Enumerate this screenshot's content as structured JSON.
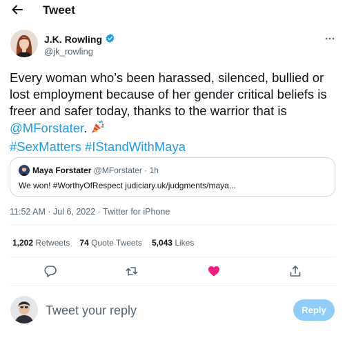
{
  "header": {
    "title": "Tweet"
  },
  "author": {
    "name": "J.K. Rowling",
    "handle": "@jk_rowling",
    "verified": true
  },
  "tweet": {
    "text_main": "Every woman who’s been harassed, silenced, bullied or lost employment because of her gender critical beliefs is freer and safer today, thanks to the warrior that is ",
    "mention": "@MForstater",
    "text_after_mention": ".",
    "emoji": "party-popper",
    "hashtag_1": "#SexMatters",
    "hashtag_2": "#IStandWithMaya"
  },
  "quote": {
    "name": "Maya Forstater",
    "handle_time": "@MForstater · 1h",
    "text": "We won! #WorthyOfRespect  judiciary.uk/judgments/maya..."
  },
  "meta": {
    "timestamp": "11:52 AM · Jul 6, 2022 · Twitter for iPhone"
  },
  "stats": {
    "retweets_count": "1,202",
    "retweets_label": "Retweets",
    "quotes_count": "74",
    "quotes_label": "Quote Tweets",
    "likes_count": "5,043",
    "likes_label": "Likes"
  },
  "actions": [
    "reply-icon",
    "retweet-icon",
    "like-icon",
    "share-icon"
  ],
  "reply": {
    "placeholder": "Tweet your reply",
    "button_label": "Reply"
  },
  "colors": {
    "accent": "#1d9bf0",
    "like": "#f91880",
    "reply_button": "#8ecdf8",
    "secondary_text": "#536471"
  }
}
